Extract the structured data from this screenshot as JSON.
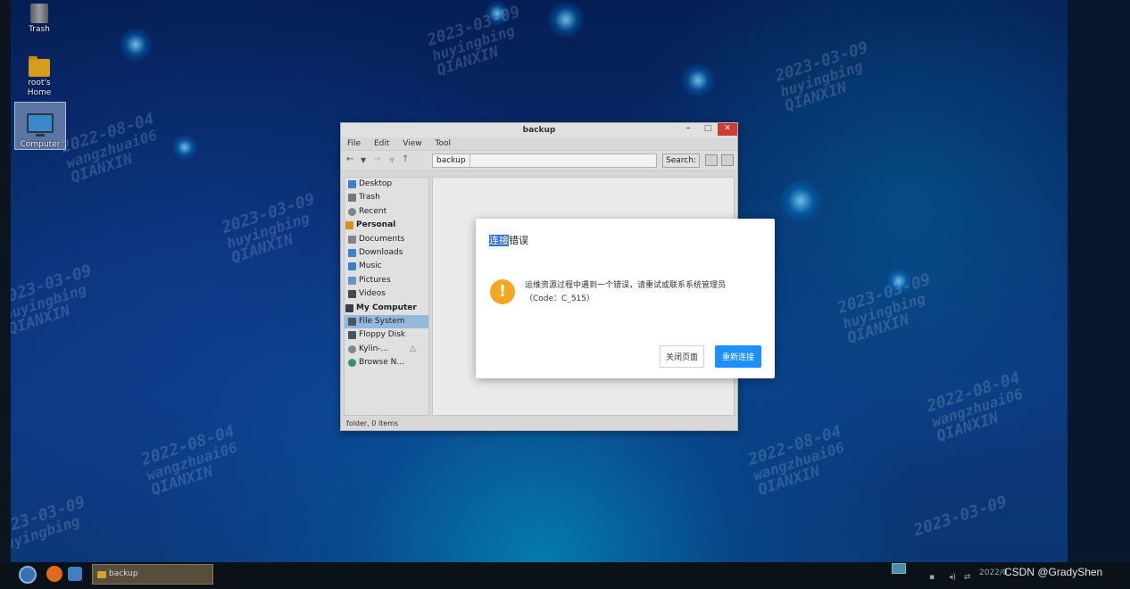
{
  "desktop": {
    "icons": [
      {
        "label": "Trash"
      },
      {
        "label": "root's\nHome"
      },
      {
        "label": "Computer"
      }
    ],
    "watermark": {
      "date": "2023-03-09",
      "user": "huyingbing",
      "org": "QIANXIN",
      "date2": "2022-08-04",
      "user2": "wangzhuai06"
    }
  },
  "file_manager": {
    "title": "backup",
    "controls": {
      "minimize": "–",
      "maximize": "□",
      "close": "✕"
    },
    "menu": [
      "File",
      "Edit",
      "View",
      "Tool"
    ],
    "path_segment": "backup",
    "search_label": "Search:",
    "sidebar": [
      {
        "label": "Desktop",
        "icon": "desktop-icon",
        "color": "#3b88d6"
      },
      {
        "label": "Trash",
        "icon": "trash-icon",
        "color": "#7a7d82"
      },
      {
        "label": "Recent",
        "icon": "recent-icon",
        "color": "#8a8d92"
      },
      {
        "label": "Personal",
        "icon": "home-icon",
        "color": "#e09a22",
        "heading": true
      },
      {
        "label": "Documents",
        "icon": "documents-icon",
        "color": "#8a8d92"
      },
      {
        "label": "Downloads",
        "icon": "downloads-icon",
        "color": "#3b88d6"
      },
      {
        "label": "Music",
        "icon": "music-icon",
        "color": "#3b88d6"
      },
      {
        "label": "Pictures",
        "icon": "pictures-icon",
        "color": "#6a9fcf"
      },
      {
        "label": "Videos",
        "icon": "videos-icon",
        "color": "#4a4d55"
      },
      {
        "label": "My Computer",
        "icon": "computer-icon",
        "color": "#3c4450",
        "heading": true
      },
      {
        "label": "File System",
        "icon": "filesystem-icon",
        "color": "#4e5a66",
        "selected": true
      },
      {
        "label": "Floppy Disk",
        "icon": "floppy-icon",
        "color": "#4e5a66"
      },
      {
        "label": "Kylin-...",
        "icon": "disc-icon",
        "color": "#8a8d92"
      },
      {
        "label": "Browse N...",
        "icon": "network-icon",
        "color": "#3a9a6a"
      }
    ],
    "status": "folder, 0 items"
  },
  "dialog": {
    "title_highlight": "连接",
    "title_rest": "错误",
    "message_line1": "运维资源过程中遇到一个错误，请重试或联系系统管理员",
    "message_line2": "（Code：C_515）",
    "close_button": "关闭页面",
    "retry_button": "重新连接",
    "accent_color": "#1e90ff",
    "warning_color": "#f5a623"
  },
  "taskbar": {
    "task_label": "backup",
    "clock": "2022/0",
    "watermark_text": "CSDN @GradyShen"
  }
}
